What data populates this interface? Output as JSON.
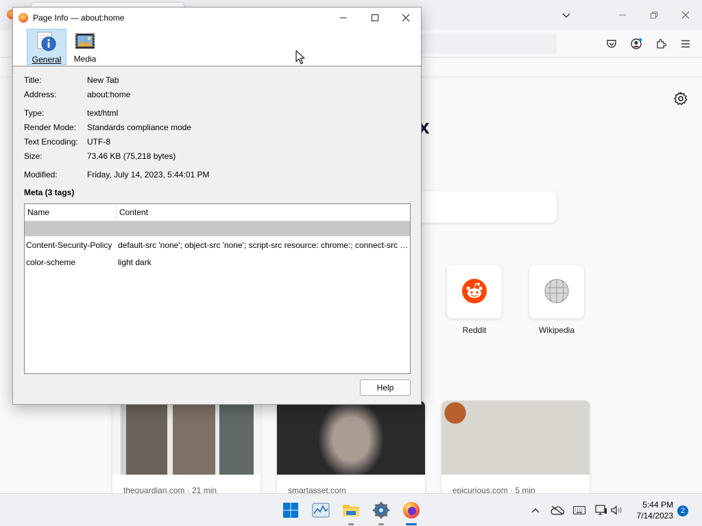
{
  "dialog": {
    "title": "Page Info — about:home",
    "tabs": [
      {
        "label": "General",
        "icon": "info-icon"
      },
      {
        "label": "Media",
        "icon": "media-icon"
      }
    ],
    "fields": {
      "title_label": "Title:",
      "title_value": "New Tab",
      "address_label": "Address:",
      "address_value": "about:home",
      "type_label": "Type:",
      "type_value": "text/html",
      "render_label": "Render Mode:",
      "render_value": "Standards compliance mode",
      "encoding_label": "Text Encoding:",
      "encoding_value": "UTF-8",
      "size_label": "Size:",
      "size_value": "73.46 KB (75,218 bytes)",
      "modified_label": "Modified:",
      "modified_value": "Friday, July 14, 2023, 5:44:01 PM"
    },
    "meta_heading": "Meta (3 tags)",
    "meta_table": {
      "columns": [
        "Name",
        "Content"
      ],
      "rows": [
        {
          "name": "",
          "content": ""
        },
        {
          "name": "Content-Security-Policy",
          "content": "default-src 'none'; object-src 'none'; script-src resource: chrome:; connect-src https:; img-src https: data: blob: chrome:; style-src 'unsafe-inline';"
        },
        {
          "name": "color-scheme",
          "content": "light dark"
        }
      ]
    },
    "help_label": "Help"
  },
  "background": {
    "shortcuts": [
      {
        "label": "Reddit",
        "icon": "reddit-icon"
      },
      {
        "label": "Wikipedia",
        "icon": "wikipedia-icon"
      }
    ],
    "stories": [
      {
        "source": "theguardian.com · 21 min"
      },
      {
        "source": "smartasset.com"
      },
      {
        "source": "epicurious.com · 5 min"
      }
    ],
    "logo_fragment": "x"
  },
  "taskbar": {
    "apps": [
      "windows-start-icon",
      "task-manager-icon",
      "file-explorer-icon",
      "settings-icon",
      "firefox-icon"
    ],
    "time": "5:44 PM",
    "date": "7/14/2023",
    "notifications": "2"
  },
  "colors": {
    "selection_row": "#c8c8c8",
    "general_tab_bg": "#cce4f7",
    "firefox_orange": "#ff7139",
    "reddit_orange": "#ff4500",
    "badge_blue": "#0067c0"
  }
}
